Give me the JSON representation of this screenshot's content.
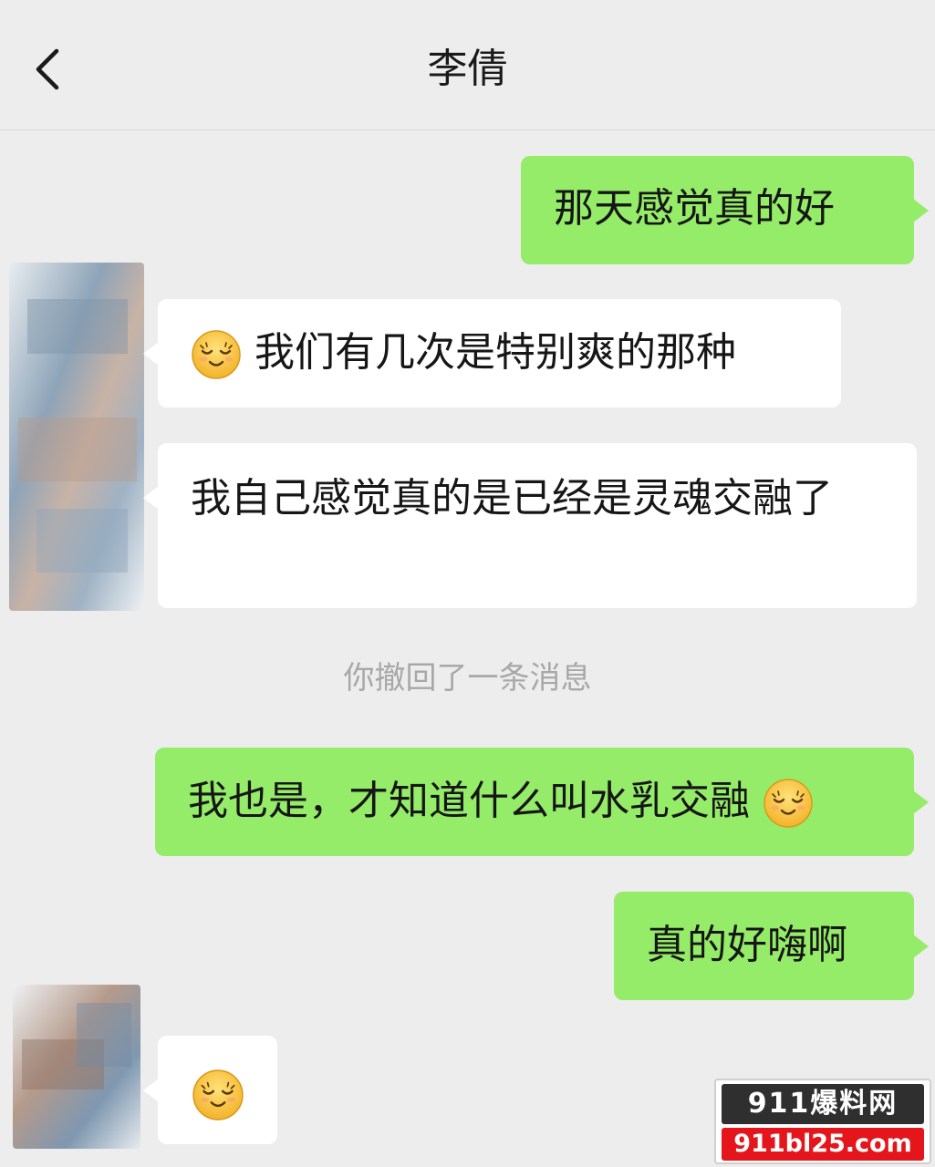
{
  "header": {
    "title": "李倩",
    "back_icon": "chevron-left-icon"
  },
  "messages": [
    {
      "from": "me",
      "text": "那天感觉真的好"
    },
    {
      "from": "them",
      "emoji": "smiling-face-with-closed-eyes-icon",
      "text": "我们有几次是特别爽的那种"
    },
    {
      "from": "them",
      "text": "我自己感觉真的是已经是灵魂交融了"
    },
    {
      "system": "你撤回了一条消息"
    },
    {
      "from": "me",
      "text": "我也是，才知道什么叫水乳交融",
      "emoji": "smiling-face-with-closed-eyes-icon"
    },
    {
      "from": "me",
      "text": "真的好嗨啊"
    },
    {
      "from": "them",
      "emoji": "smiling-face-with-closed-eyes-icon",
      "text": ""
    }
  ],
  "watermark": {
    "brand": "911爆料网",
    "url": "911bl25.com"
  },
  "colors": {
    "background": "#ededed",
    "my_bubble": "#95ec69",
    "their_bubble": "#ffffff",
    "system_text": "#a8a8a8",
    "watermark_red": "#e4161b"
  }
}
